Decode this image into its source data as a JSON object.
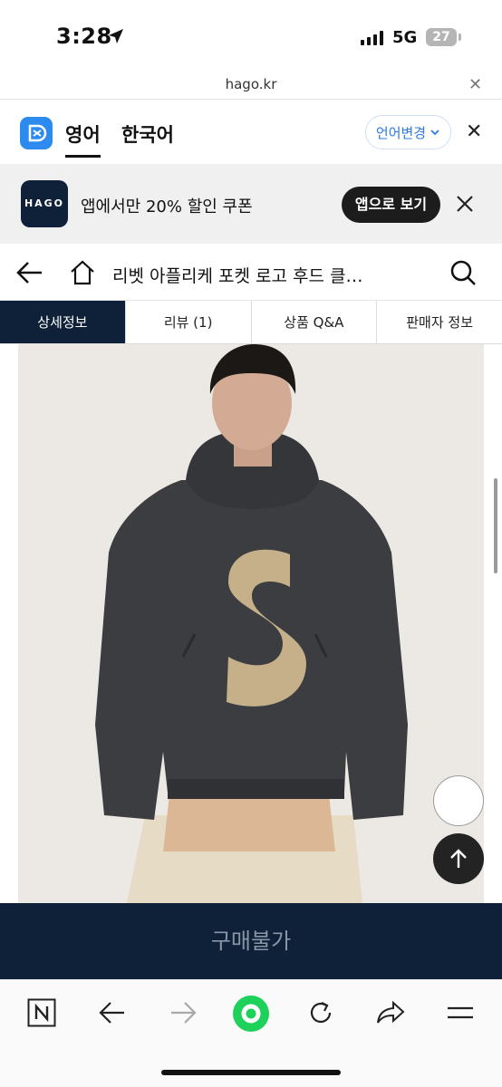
{
  "status_bar": {
    "time": "3:28",
    "network": "5G",
    "battery": "27"
  },
  "browser": {
    "url": "hago.kr",
    "close_icon": "close-icon"
  },
  "translate_bar": {
    "active_language": "영어",
    "other_language": "한국어",
    "change_label": "언어변경",
    "accent_color": "#2d7be0"
  },
  "promo": {
    "logo_text": "HAGO",
    "message": "앱에서만 20% 할인 쿠폰",
    "button_label": "앱으로 보기"
  },
  "page": {
    "title": "리벳 아플리케 포켓 로고 후드 클…"
  },
  "tabs": [
    {
      "label": "상세정보",
      "active": true
    },
    {
      "label": "리뷰 (1)",
      "active": false
    },
    {
      "label": "상품 Q&A",
      "active": false
    },
    {
      "label": "판매자 정보",
      "active": false
    }
  ],
  "buy_bar": {
    "label": "구매불가",
    "color": "#0f2138"
  },
  "toolbar": {
    "icons": [
      "naver-icon",
      "back-icon",
      "forward-icon",
      "green-dot-icon",
      "refresh-icon",
      "share-icon",
      "menu-icon"
    ]
  }
}
